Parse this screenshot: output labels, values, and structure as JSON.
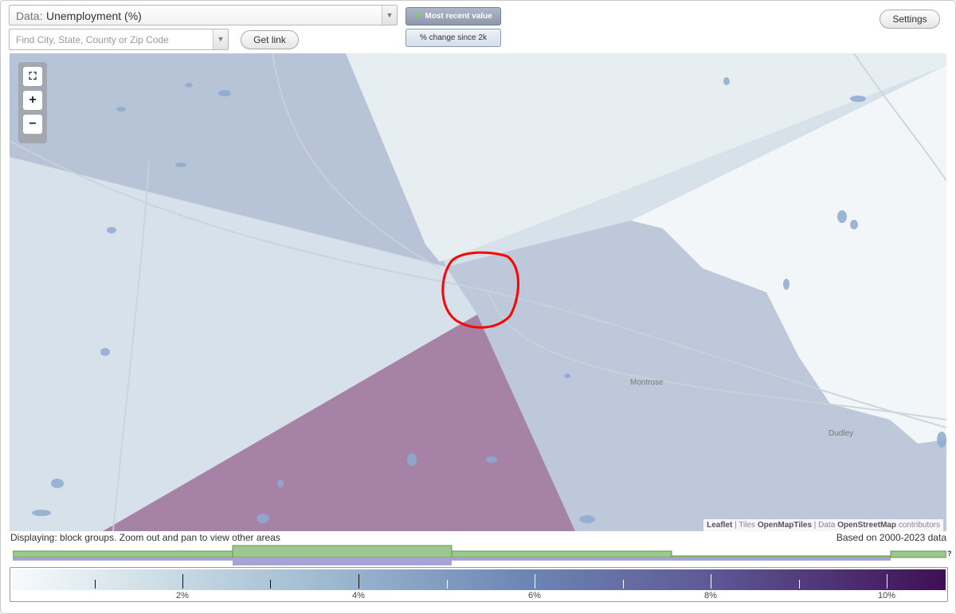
{
  "header": {
    "data_prefix": "Data:",
    "data_value": "Unemployment (%)",
    "search_placeholder": "Find City, State, County or Zip Code",
    "get_link_label": "Get link",
    "mode_recent_label": "Most recent value",
    "mode_change_label": "% change since 2k",
    "settings_label": "Settings"
  },
  "map": {
    "place_labels": [
      "Montrose",
      "Dudley"
    ],
    "attribution": {
      "leaflet": "Leaflet",
      "sep1": " | Tiles ",
      "tiles": "OpenMapTiles",
      "sep2": " | Data ",
      "data": "OpenStreetMap",
      "suffix": " contributors"
    },
    "zoom_controls": [
      "fullscreen-icon",
      "zoom-in-icon",
      "zoom-out-icon"
    ],
    "highlight_color": "#ff0000"
  },
  "footer": {
    "displaying": "Displaying: block groups. Zoom out and pan to view other areas",
    "based_on": "Based on 2000-2023 data",
    "coverage_help": "?"
  },
  "legend": {
    "tick_labels": [
      "2%",
      "4%",
      "6%",
      "8%",
      "10%"
    ],
    "colors": {
      "low": "#f7fbfd",
      "mid": "#6c86b4",
      "high": "#3f0f55"
    }
  }
}
